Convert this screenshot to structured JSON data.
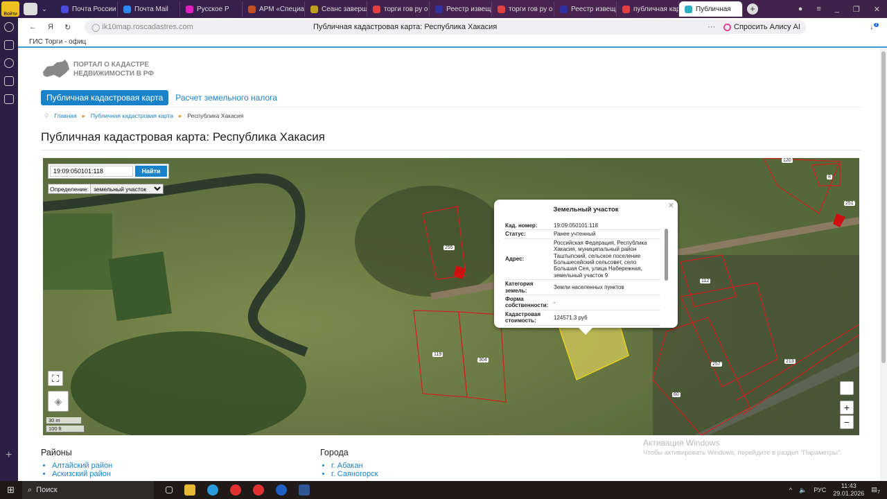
{
  "browser": {
    "login_label": "Войти",
    "tabs": [
      {
        "label": "Почта России",
        "color": "#4a4ad8"
      },
      {
        "label": "Почта Mail",
        "color": "#2a8af0"
      },
      {
        "label": "Русское Р",
        "color": "#e020c0"
      },
      {
        "label": "АРМ «Специал",
        "color": "#c05020"
      },
      {
        "label": "Сеанс заверш",
        "color": "#c0a020"
      },
      {
        "label": "торги гов ру о",
        "color": "#e04040"
      },
      {
        "label": "Реестр извещ",
        "color": "#3030a0"
      },
      {
        "label": "торги гов ру о",
        "color": "#e04040"
      },
      {
        "label": "Реестр извещ",
        "color": "#3030a0"
      },
      {
        "label": "публичная кар",
        "color": "#e04040"
      },
      {
        "label": "Публичная",
        "color": "#2ab0c0"
      }
    ],
    "url": "ik10map.roscadastres.com",
    "page_title": "Публичная кадастровая карта: Республика Хакасия",
    "alice_label": "Спросить Алису AI",
    "download_badge": "1",
    "bookmark": "ГИС Торги - офиц"
  },
  "site": {
    "logo_line1": "ПОРТАЛ О КАДАСТРЕ",
    "logo_line2": "НЕДВИЖИМОСТИ В РФ",
    "nav": [
      "Публичная кадастровая карта",
      "Расчет земельного налога"
    ],
    "breadcrumb": [
      "Главная",
      "Публичная кадастровая карта",
      "Республика Хакасия"
    ],
    "heading": "Публичная кадастровая карта: Республика Хакасия"
  },
  "map": {
    "search_value": "19:09:050101:118",
    "search_button": "Найти",
    "definition_label": "Определение:",
    "definition_value": "земельный участок",
    "scale_m": "30 m",
    "scale_ft": "100 ft",
    "zoom_in": "+",
    "zoom_out": "−",
    "parcel_labels": [
      "120",
      "8",
      "251",
      "255",
      "112",
      "119",
      "304",
      "257",
      "60",
      "213"
    ],
    "popup": {
      "title": "Земельный участок",
      "rows": [
        {
          "k": "Кад. номер:",
          "v": "19:09:050101:118"
        },
        {
          "k": "Статус:",
          "v": "Ранее учтенный"
        },
        {
          "k": "Адрес:",
          "v": "Российская Федерация, Республика Хакасия, муниципальный район Таштыпский, сельское поселение Большесейский сельсовет, село Большая Сея, улица Набережная, земельный участок 9"
        },
        {
          "k": "Категория земель:",
          "v": "Земли населенных пунктов"
        },
        {
          "k": "Форма собственности:",
          "v": "-"
        },
        {
          "k": "Кадастровая стоимость:",
          "v": "124571.3 руб"
        }
      ]
    }
  },
  "lists": {
    "districts_title": "Районы",
    "districts": [
      "Алтайский район",
      "Аскизский район"
    ],
    "cities_title": "Города",
    "cities": [
      "г. Абакан",
      "г. Саяногорск"
    ]
  },
  "windows": {
    "activation_title": "Активация Windows",
    "activation_text": "Чтобы активировать Windows, перейдите в раздел \"Параметры\".",
    "search_label": "Поиск",
    "lang": "РУС",
    "time": "11:43",
    "date": "29.01.2026",
    "notif_count": "7"
  }
}
